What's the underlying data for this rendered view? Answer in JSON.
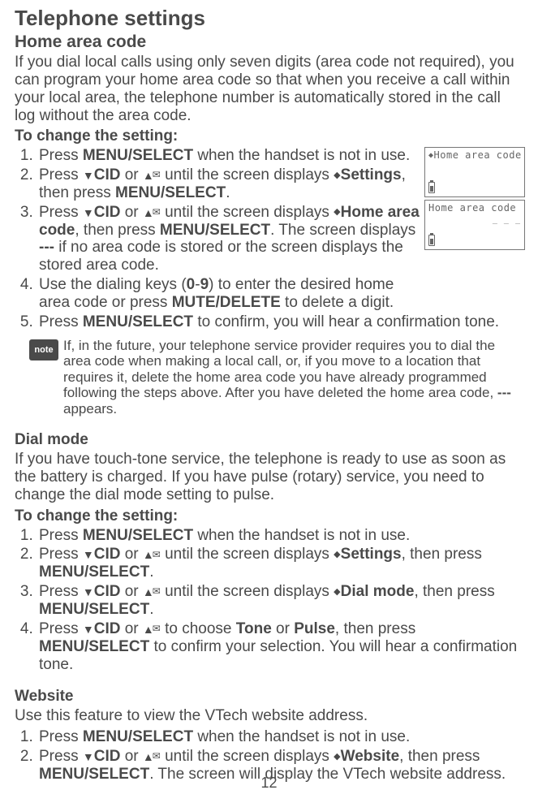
{
  "page_title": "Telephone settings",
  "page_number": "12",
  "note_label": "note",
  "icons": {
    "down": "▼",
    "up": "▲",
    "envelope": "✉",
    "diamond": "◆",
    "updown": "◆"
  },
  "screens": {
    "screen1_line": "Home area code",
    "screen2_line1": "Home area code",
    "screen2_line2": "_ _ _"
  },
  "home_area": {
    "heading": "Home area code",
    "intro": "If you dial local calls using only seven digits (area code not required), you can program your home area code so that when you receive a call within your local area, the telephone number is automatically stored in the call log without the area code.",
    "sub_heading": "To change the setting:",
    "step1_a": "Press ",
    "step1_b": "MENU/",
    "step1_c": "SELECT",
    "step1_d": " when the handset is not in use.",
    "step2_a": "Press ",
    "step2_cid": "CID",
    "step2_b": " or ",
    "step2_c": " until the screen displays ",
    "step2_settings": "Settings",
    "step2_d": ", then press ",
    "step2_menu": "MENU",
    "step2_select": "/SELECT",
    "step2_e": ".",
    "step3_a": "Press ",
    "step3_b": " or ",
    "step3_c": " until the screen displays ",
    "step3_hac": "Home area code",
    "step3_d": ", then press ",
    "step3_e": ". The screen displays ",
    "step3_dashes": "---",
    "step3_f": " if no area code is stored or the screen displays the stored area code.",
    "step4_a": "Use the dialing keys (",
    "step4_0": "0",
    "step4_dash": "-",
    "step4_9": "9",
    "step4_b": ") to enter the desired home area code or press ",
    "step4_mute": "MUTE",
    "step4_delete": "/DELETE",
    "step4_c": " to delete a digit.",
    "step5_a": "Press ",
    "step5_b": " to confirm, you will hear a confirmation tone.",
    "note_text_a": "If, in the future, your telephone service provider requires you to dial the area code when making a local call, or, if you move to a location that requires it, delete the home area code you have already programmed following the steps above. After you have deleted the home area code, ",
    "note_dashes": "---",
    "note_text_b": " appears."
  },
  "dial_mode": {
    "heading": "Dial mode",
    "intro": "If you have touch-tone service, the telephone is ready to use as soon as the battery is charged. If you have pulse (rotary) service, you need to change the dial mode setting to pulse.",
    "sub_heading": "To change the setting:",
    "step1_a": "Press ",
    "step1_b": " when the handset is not in use.",
    "step2_a": "Press ",
    "step2_b": " or ",
    "step2_c": " until the screen displays ",
    "step2_settings": "Settings",
    "step2_d": ", then press ",
    "step2_e": ".",
    "step3_a": "Press ",
    "step3_b": " or ",
    "step3_c": " until the screen displays ",
    "step3_dm": "Dial mode",
    "step3_d": ", then press ",
    "step3_e": ".",
    "step4_a": "Press ",
    "step4_b": " or ",
    "step4_c": " to choose ",
    "step4_tone": "Tone",
    "step4_or": " or ",
    "step4_pulse": "Pulse",
    "step4_d": ", then press ",
    "step4_e": " to confirm your selection. You will hear a confirmation tone."
  },
  "website": {
    "heading": "Website",
    "intro": "Use this feature to view the VTech website address.",
    "step1_a": "Press ",
    "step1_b": " when the handset is not in use.",
    "step2_a": "Press ",
    "step2_b": " or ",
    "step2_c": " until the screen displays ",
    "step2_website": "Website",
    "step2_d": ", then press ",
    "step2_e": ". The screen will display the VTech website address."
  }
}
